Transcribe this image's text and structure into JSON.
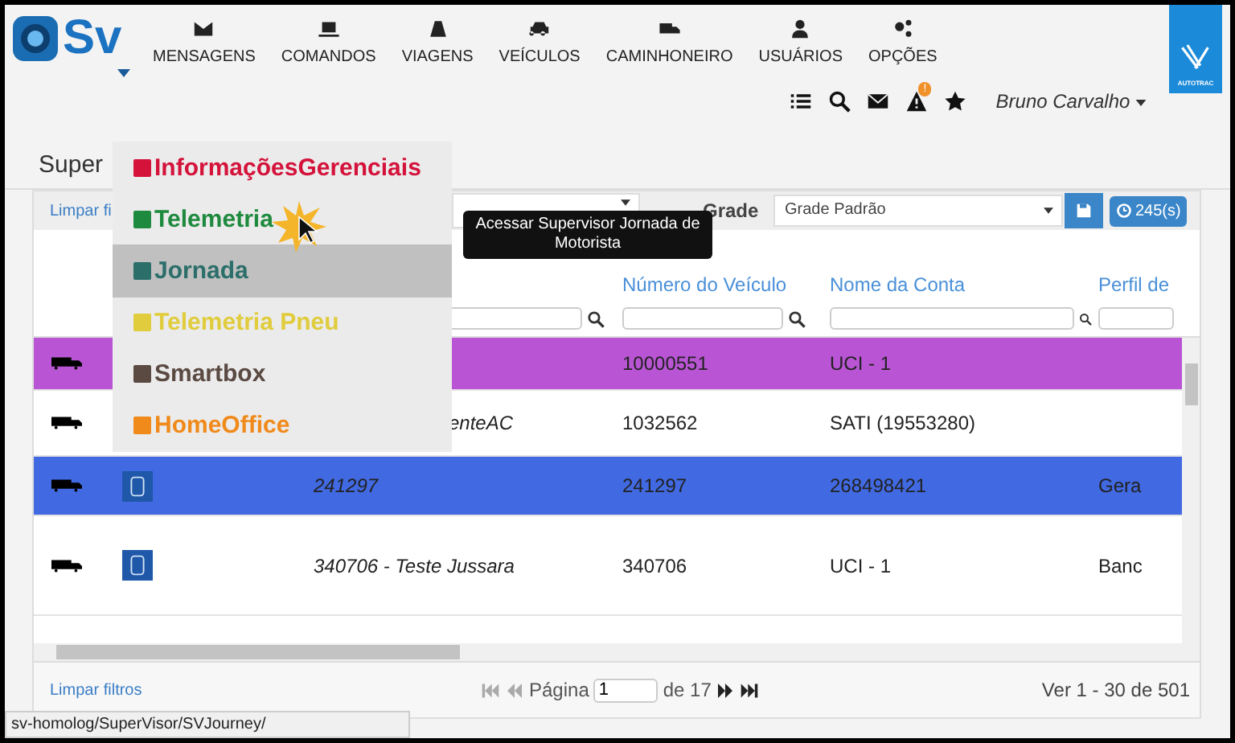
{
  "logo": {
    "text": "Sv"
  },
  "nav": [
    {
      "label": "MENSAGENS"
    },
    {
      "label": "COMANDOS"
    },
    {
      "label": "VIAGENS"
    },
    {
      "label": "VEÍCULOS"
    },
    {
      "label": "CAMINHONEIRO"
    },
    {
      "label": "USUÁRIOS"
    },
    {
      "label": "OPÇÕES"
    }
  ],
  "brand": {
    "text": "AUTOTRAC"
  },
  "alert_badge": "!",
  "user": {
    "name": "Bruno Carvalho"
  },
  "page_title": "Super",
  "menu": [
    {
      "label": "InformaçõesGerenciais",
      "color": "#d4123a",
      "selected": false
    },
    {
      "label": "Telemetria",
      "color": "#1e8a3e",
      "selected": false
    },
    {
      "label": "Jornada",
      "color": "#2b6e6a",
      "selected": true
    },
    {
      "label": "Telemetria Pneu",
      "color": "#e0cc3c",
      "selected": false
    },
    {
      "label": "Smartbox",
      "color": "#5a4a42",
      "selected": false
    },
    {
      "label": "HomeOffice",
      "color": "#f08a1a",
      "selected": false
    }
  ],
  "tooltip": "Acessar Supervisor Jornada de Motorista",
  "toolbar": {
    "clear": "Limpar fi",
    "grade_label": "Grade",
    "grade_value": "Grade Padrão",
    "timer": "245(s)"
  },
  "table": {
    "columns": [
      {
        "label": "Número do Veículo"
      },
      {
        "label": "Nome da Conta"
      },
      {
        "label": "Perfil de"
      }
    ],
    "rows": [
      {
        "color": "#b955d4",
        "name": "",
        "number": "10000551",
        "account": "UCI - 1",
        "profile": "",
        "vehicle_icon": false
      },
      {
        "color": "#ffffff",
        "name": "enteAC",
        "number": "1032562",
        "account": "SATI (19553280)",
        "profile": "",
        "vehicle_icon": false
      },
      {
        "color": "#4169e1",
        "name": "241297",
        "number": "241297",
        "account": "268498421",
        "profile": "Gera",
        "vehicle_icon": true
      },
      {
        "color": "#ffffff",
        "name": "340706 - Teste Jussara",
        "number": "340706",
        "account": "UCI - 1",
        "profile": "Banc",
        "vehicle_icon": true
      }
    ]
  },
  "footer": {
    "clear": "Limpar filtros",
    "page_label": "Página",
    "page": "1",
    "page_total": "de 17",
    "range": "Ver 1 - 30 de 501"
  },
  "status_url": "sv-homolog/SuperVisor/SVJourney/"
}
